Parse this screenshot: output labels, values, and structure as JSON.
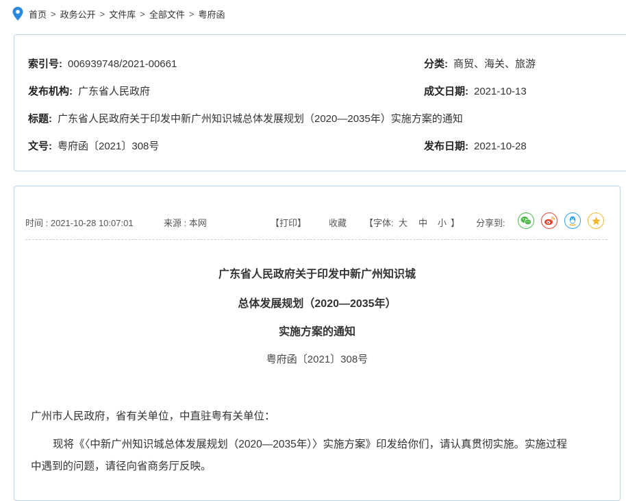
{
  "breadcrumb": {
    "items": [
      "首页",
      "政务公开",
      "文件库",
      "全部文件",
      "粤府函"
    ],
    "separator": ">"
  },
  "info": {
    "index_label": "索引号:",
    "index_value": "006939748/2021-00661",
    "category_label": "分类:",
    "category_value": "商贸、海关、旅游",
    "publisher_label": "发布机构:",
    "publisher_value": "广东省人民政府",
    "written_date_label": "成文日期:",
    "written_date_value": "2021-10-13",
    "title_label": "标题:",
    "title_value": "广东省人民政府关于印发中新广州知识城总体发展规划（2020—2035年）实施方案的通知",
    "docno_label": "文号:",
    "docno_value": "粤府函〔2021〕308号",
    "pub_date_label": "发布日期:",
    "pub_date_value": "2021-10-28"
  },
  "toolbar": {
    "time": "时间 : 2021-10-28 10:07:01",
    "source": "来源 : 本网",
    "print": "【打印】",
    "favorite": "收藏",
    "font_open": "【字体:",
    "font_large": "大",
    "font_medium": "中",
    "font_small": "小",
    "font_close": "】",
    "share_label": "分享到:"
  },
  "share_icons": [
    "wechat-icon",
    "weibo-icon",
    "qq-icon",
    "qzone-icon"
  ],
  "colors": {
    "border": "#b8d3ec",
    "pin": "#2b8ae0",
    "wechat": "#4cb84a",
    "weibo": "#e6432f",
    "qq": "#2aa3e8",
    "qzone": "#f4b62a"
  },
  "article": {
    "title_line1": "广东省人民政府关于印发中新广州知识城",
    "title_line2": "总体发展规划（2020—2035年）",
    "title_line3": "实施方案的通知",
    "doc_no": "粤府函〔2021〕308号",
    "salutation": "广州市人民政府，省有关单位，中直驻粤有关单位：",
    "body_line1": "现将《〈中新广州知识城总体发展规划（2020—2035年）〉实施方案》印发给你们，请认真贯彻实施。实施过程",
    "body_line2": "中遇到的问题，请径向省商务厅反映。"
  }
}
